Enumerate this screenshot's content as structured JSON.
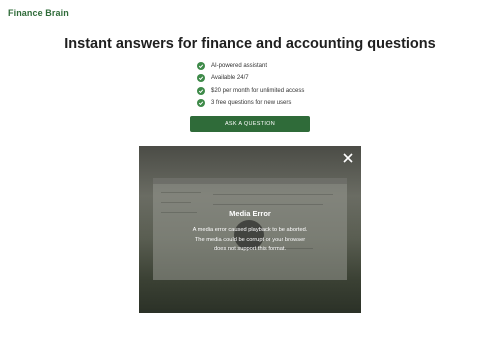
{
  "header": {
    "logo_text": "Finance Brain"
  },
  "hero": {
    "headline": "Instant answers for finance and accounting questions",
    "features": [
      "AI-powered assistant",
      "Available 24/7",
      "$20 per month for unlimited access",
      "3 free questions for new users"
    ],
    "cta_label": "ASK A QUESTION"
  },
  "video_modal": {
    "error_title": "Media Error",
    "error_message": "A media error caused playback to be aborted. The media could be corrupt or your browser does not support this format."
  },
  "colors": {
    "brand_green": "#2f6b39",
    "check_green": "#3e8a49"
  },
  "icons": {
    "feature": "check-circle-icon",
    "close": "close-icon"
  }
}
